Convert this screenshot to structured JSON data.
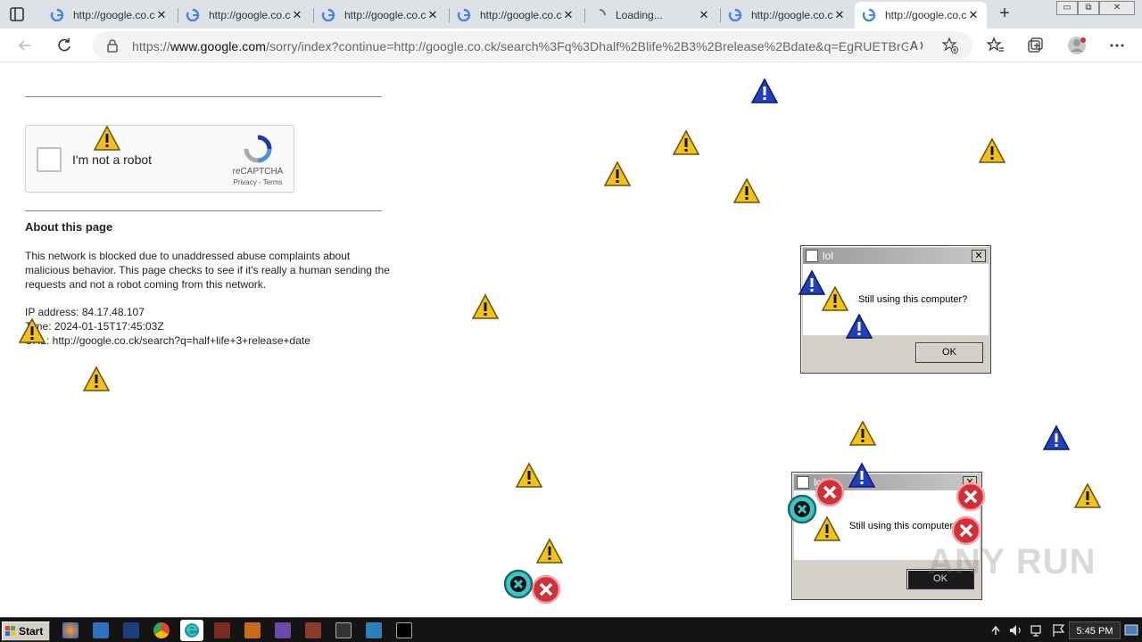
{
  "browser": {
    "tabs": [
      {
        "title": "http://google.co.ck",
        "state": "normal"
      },
      {
        "title": "http://google.co.ck",
        "state": "normal"
      },
      {
        "title": "http://google.co.ck",
        "state": "normal"
      },
      {
        "title": "http://google.co.ck",
        "state": "normal"
      },
      {
        "title": "Loading...",
        "state": "loading"
      },
      {
        "title": "http://google.co.ck",
        "state": "normal"
      },
      {
        "title": "http://google.co.ck",
        "state": "active"
      }
    ],
    "close_glyph": "✕",
    "new_tab_glyph": "+",
    "window_buttons": [
      "▭",
      "⧉",
      "✕"
    ],
    "address": {
      "prefix": "https://",
      "host": "www.google.com",
      "path": "/sorry/index?continue=http://google.co.ck/search%3Fq%3Dhalf%2Blife%2B3%2Brelease%2Bdate&q=EgRUETBrGJ7..."
    }
  },
  "page": {
    "captcha": {
      "label": "I'm not a robot",
      "brand": "reCAPTCHA",
      "links": "Privacy - Terms"
    },
    "about_heading": "About this page",
    "about_text": "This network is blocked due to unaddressed abuse complaints about malicious behavior. This page checks to see if it's really a human sending the requests and not a robot coming from this network.",
    "ip_line": "IP address: 84.17.48.107",
    "time_line": "Time: 2024-01-15T17:45:03Z",
    "url_line": "URL: http://google.co.ck/search?q=half+life+3+release+date"
  },
  "dialogs": [
    {
      "title": "lol",
      "message": "Still using this computer?",
      "ok": "OK"
    },
    {
      "title": "lol",
      "message": "Still using this computer?",
      "ok": "OK"
    }
  ],
  "taskbar": {
    "start_label": "Start",
    "clock": "5:45 PM"
  },
  "watermark": "ANY RUN",
  "colors": {
    "tabstrip": "#dee1e6",
    "warning_yellow": "#f2c21b",
    "warning_blue": "#1f3fbf",
    "error_red": "#d0303a",
    "taskbar": "#141414"
  }
}
